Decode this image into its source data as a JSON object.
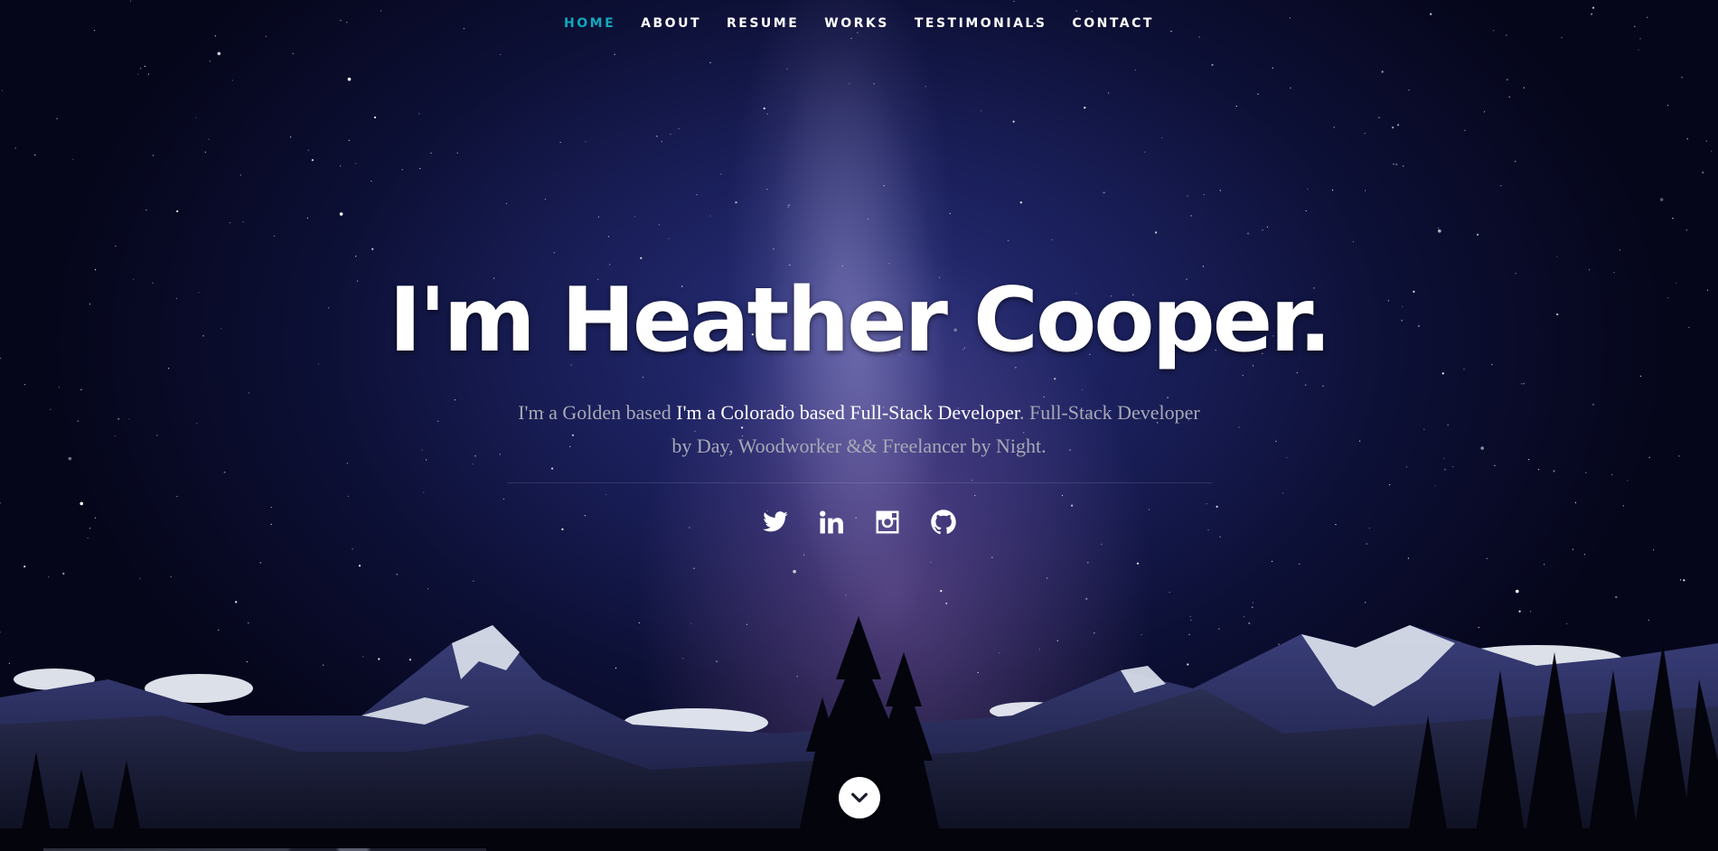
{
  "nav": {
    "items": [
      {
        "label": "HOME",
        "active": true
      },
      {
        "label": "ABOUT",
        "active": false
      },
      {
        "label": "RESUME",
        "active": false
      },
      {
        "label": "WORKS",
        "active": false
      },
      {
        "label": "TESTIMONIALS",
        "active": false
      },
      {
        "label": "CONTACT",
        "active": false
      }
    ]
  },
  "banner": {
    "headline": "I'm Heather Cooper.",
    "tagline_prefix": "I'm a Golden based ",
    "tagline_highlight": "I'm a Colorado based Full-Stack Developer",
    "tagline_suffix": ". Full-Stack Developer by Day, Woodworker && Freelancer by Night."
  },
  "social": {
    "icons": [
      "twitter-icon",
      "linkedin-icon",
      "instagram-icon",
      "github-icon"
    ]
  },
  "colors": {
    "accent": "#11a8bd",
    "text": "#ffffff",
    "muted": "#a7a9b6"
  },
  "scroll": {
    "icon": "chevron-down-icon"
  }
}
